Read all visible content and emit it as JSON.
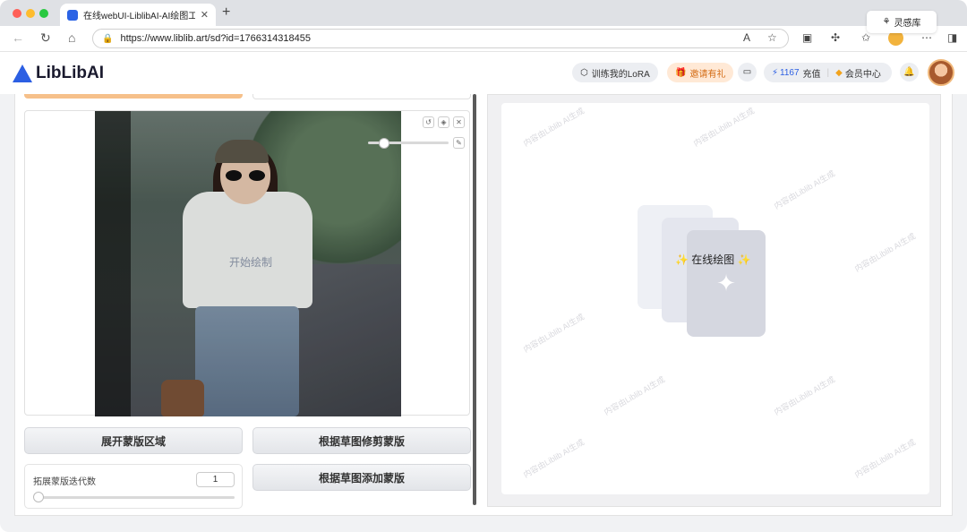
{
  "browser": {
    "tab_title": "在线webUI-LiblibAI-AI绘图工具",
    "tab_close": "✕",
    "new_tab": "+",
    "url": "https://www.liblib.art/sd?id=1766314318455"
  },
  "header": {
    "logo_text": "LibLibAI",
    "train_lora": "训练我的LoRA",
    "invite": "邀请有礼",
    "points": "1167",
    "recharge": "充值",
    "member_center": "会员中心"
  },
  "left": {
    "canvas_watermark": "开始绘制",
    "expand_mask_button": "展开蒙版区域",
    "crop_mask_button": "根据草图修剪蒙版",
    "add_mask_button": "根据草图添加蒙版",
    "iter_label": "拓展蒙版迭代数",
    "iter_value": "1"
  },
  "right": {
    "inspiration": "灵感库",
    "online_draw": "在线绘图",
    "watermark": "内容由Liblib AI生成"
  },
  "colors": {
    "brand_blue": "#2c5fe3",
    "invite_orange": "#ffe9d6",
    "orange_bar": "#f6c08a"
  }
}
